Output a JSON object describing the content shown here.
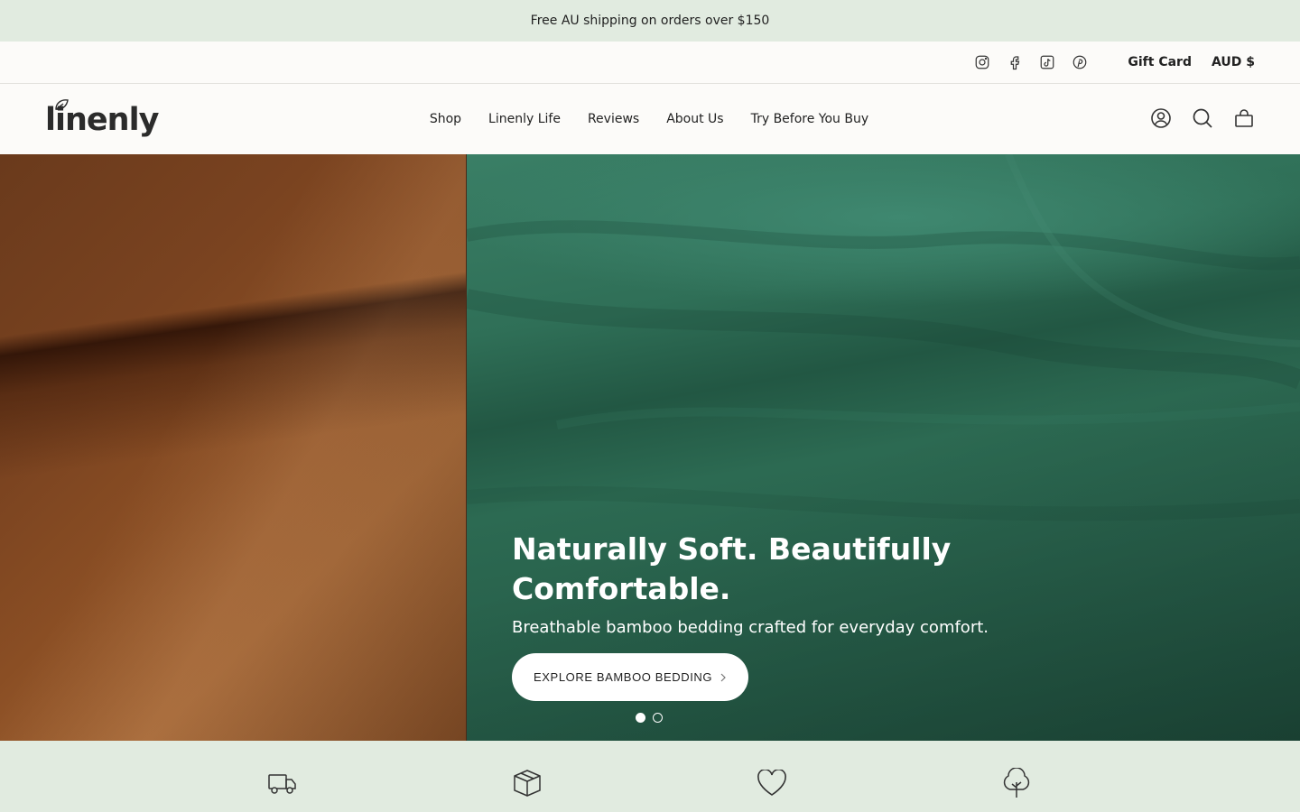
{
  "announcement": {
    "text": "Free AU shipping on orders over $150"
  },
  "utility": {
    "social": [
      "instagram-icon",
      "facebook-icon",
      "tiktok-icon",
      "pinterest-icon"
    ],
    "gift_card": "Gift Card",
    "currency": "AUD $"
  },
  "header": {
    "logo_text": "linenly",
    "nav": [
      "Shop",
      "Linenly Life",
      "Reviews",
      "About Us",
      "Try Before You Buy"
    ],
    "icons": [
      "account-icon",
      "search-icon",
      "cart-icon"
    ]
  },
  "hero": {
    "title": "Naturally Soft. Beautifully Comfortable.",
    "subtitle": "Breathable bamboo bedding crafted for everyday comfort.",
    "button_label": "EXPLORE BAMBOO BEDDING",
    "slides_count": 2,
    "active_slide": 1
  },
  "features": {
    "icons": [
      "truck-icon",
      "box-icon",
      "heart-icon",
      "tree-icon"
    ]
  },
  "colors": {
    "announcement_bg": "#e1ebe0",
    "page_bg": "#fcfbf9",
    "hero_green": "#2f6f57",
    "hero_brown": "#8a4e24"
  }
}
